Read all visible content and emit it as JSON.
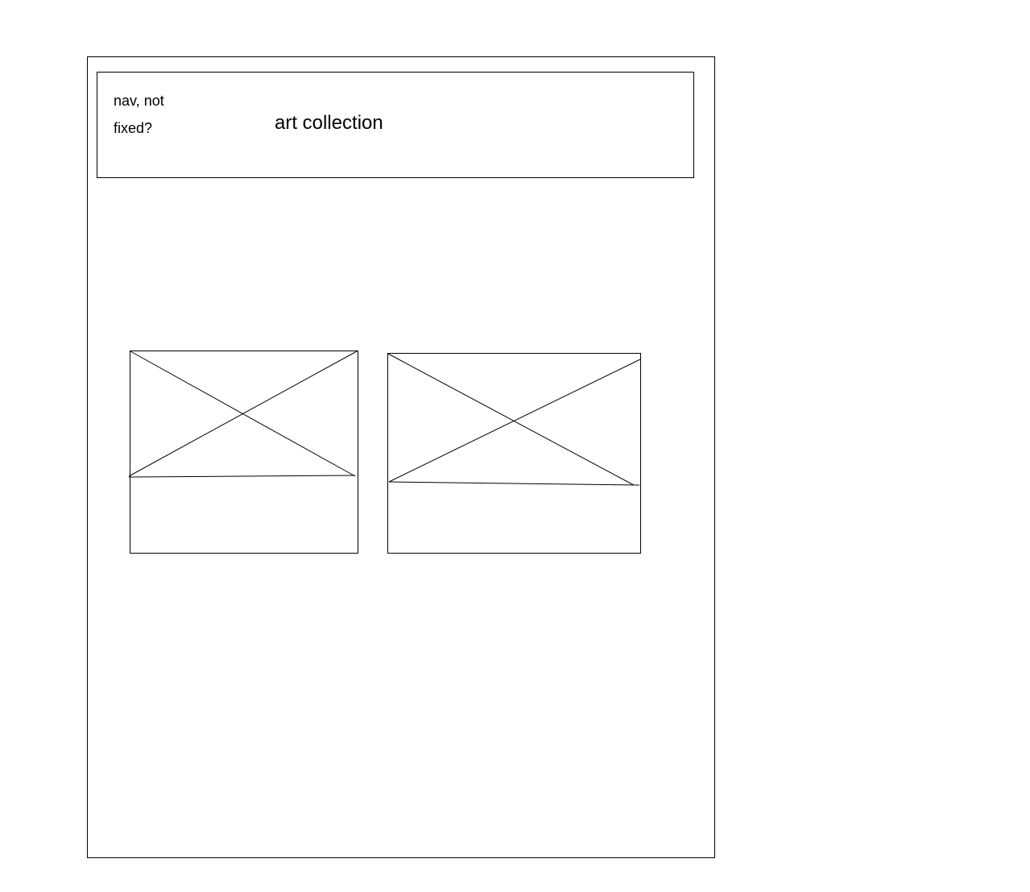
{
  "nav": {
    "note": "nav, not fixed?",
    "title": "art collection"
  },
  "cards": [
    {
      "image_icon": "image-placeholder-icon"
    },
    {
      "image_icon": "image-placeholder-icon"
    }
  ]
}
